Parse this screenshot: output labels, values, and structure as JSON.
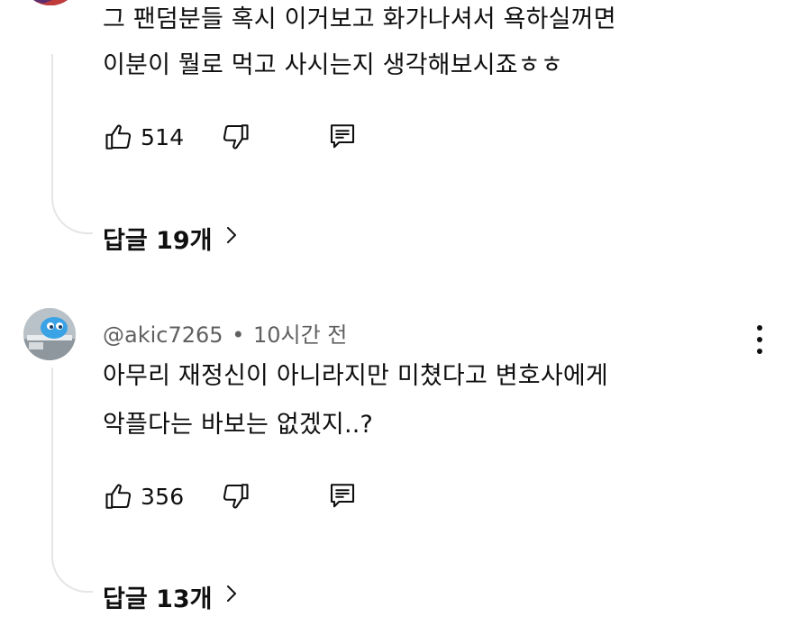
{
  "comments": [
    {
      "text_lines": [
        "그 팬덤분들 혹시 이거보고 화가나셔서 욕하실꺼면",
        "이분이 뭘로 먹고 사시는지 생각해보시죠ㅎㅎ"
      ],
      "like_count": "514",
      "replies_label": "답글 19개"
    },
    {
      "author": "@akic7265",
      "separator": "•",
      "time": "10시간 전",
      "text_lines": [
        "아무리 재정신이 아니라지만 미쳤다고 변호사에게",
        "악플다는 바보는 없겠지..?"
      ],
      "like_count": "356",
      "replies_label": "답글 13개"
    }
  ],
  "icons": {
    "like": "thumbs-up-icon",
    "dislike": "thumbs-down-icon",
    "reply": "comment-reply-icon",
    "more": "more-vertical-icon",
    "chevron": "chevron-right-icon"
  },
  "colors": {
    "text": "#0f0f0f",
    "meta": "#606060",
    "thread_line": "#e5e5e5"
  }
}
